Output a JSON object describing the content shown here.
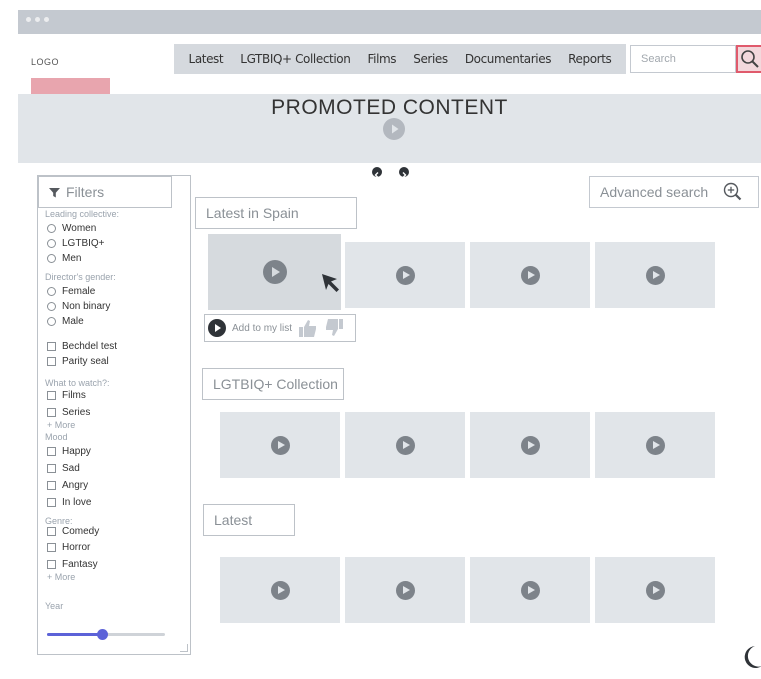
{
  "header": {
    "logo_text": "LOGO",
    "nav": [
      "Latest",
      "LGTBIQ+ Collection",
      "Films",
      "Series",
      "Documentaries",
      "Reports"
    ],
    "search_placeholder": "Search"
  },
  "promo": {
    "title": "PROMOTED CONTENT"
  },
  "sidebar": {
    "title": "Filters",
    "leading_label": "Leading collective:",
    "leading_options": [
      "Women",
      "LGTBIQ+",
      "Men"
    ],
    "gender_label": "Director's gender:",
    "gender_options": [
      "Female",
      "Non binary",
      "Male"
    ],
    "tests": [
      "Bechdel test",
      "Parity seal"
    ],
    "watch_label": "What to watch?:",
    "watch_options": [
      "Films",
      "Series"
    ],
    "more": "+ More",
    "mood_label": "Mood",
    "mood_options": [
      "Happy",
      "Sad",
      "Angry",
      "In love"
    ],
    "genre_label": "Genre:",
    "genre_options": [
      "Comedy",
      "Horror",
      "Fantasy"
    ],
    "year_label": "Year",
    "year_value": 0.47
  },
  "main": {
    "advanced_search": "Advanced search",
    "sections": [
      "Latest in Spain",
      "LGTBIQ+ Collection",
      "Latest"
    ],
    "add_to_list": "Add to my list"
  },
  "colors": {
    "accent": "#5c62d8",
    "logo_placeholder": "#e8a5ae",
    "search_highlight": "#e05a6c",
    "tile_background": "#e1e5e9"
  },
  "icons": [
    "filter-icon",
    "search-icon",
    "zoom-in-icon",
    "play-icon",
    "thumbs-up-icon",
    "thumbs-down-icon",
    "cursor-arrow-icon",
    "moon-icon",
    "arrow-left-icon",
    "arrow-right-icon"
  ]
}
